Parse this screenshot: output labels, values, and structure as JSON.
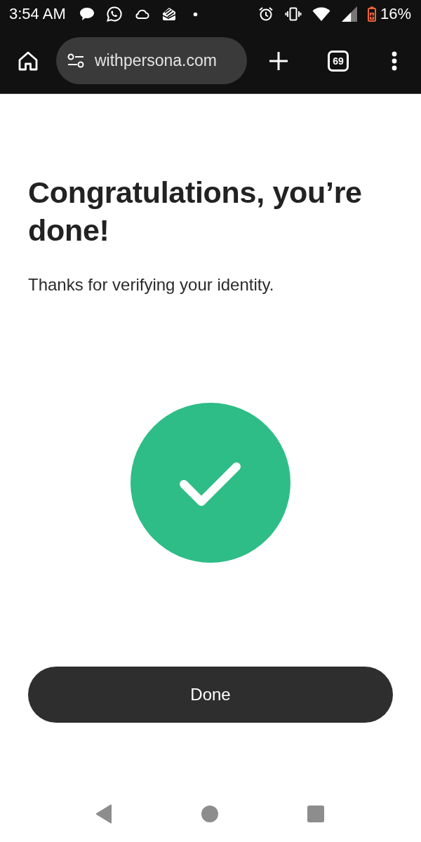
{
  "status_bar": {
    "time": "3:54 AM",
    "battery": "16%"
  },
  "browser": {
    "url": "withpersona.com",
    "tab_count": "69"
  },
  "page": {
    "title": "Congratulations, you’re done!",
    "subtitle": "Thanks for verifying your identity.",
    "button": "Done"
  }
}
